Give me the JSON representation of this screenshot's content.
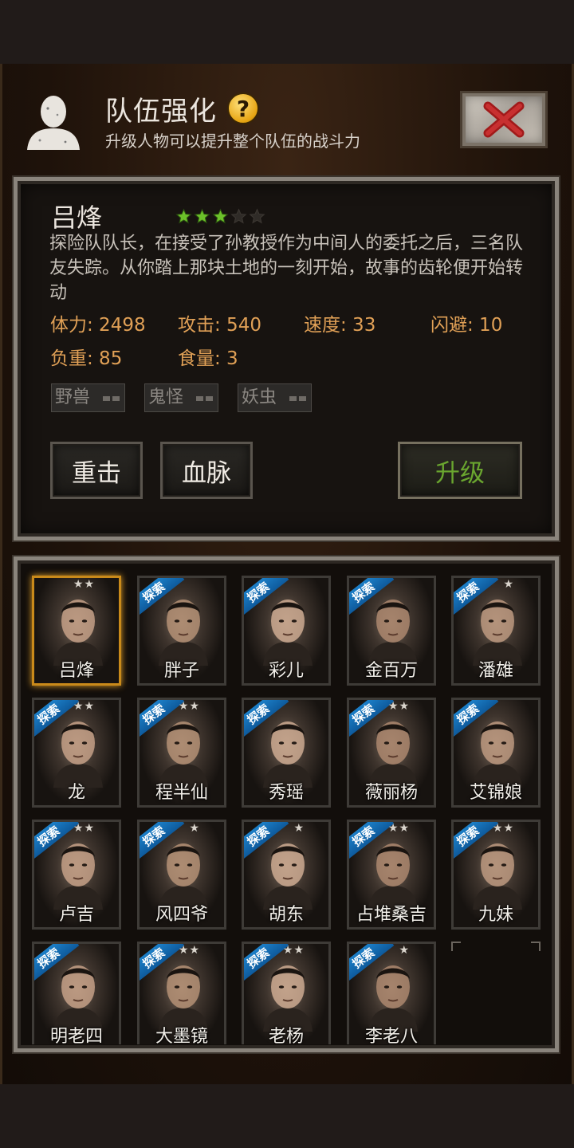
{
  "header": {
    "title": "队伍强化",
    "subtitle": "升级人物可以提升整个队伍的战斗力",
    "help_label": "?"
  },
  "character": {
    "name": "吕烽",
    "stars_filled": 3,
    "stars_total": 5,
    "description": "探险队队长，在接受了孙教授作为中间人的委托之后，三名队友失踪。从你踏上那块土地的一刻开始，故事的齿轮便开始转动",
    "stats": {
      "hp": "体力: 2498",
      "attack": "攻击: 540",
      "speed": "速度: 33",
      "dodge": "闪避: 10",
      "load": "负重: 85",
      "food": "食量: 3"
    },
    "tags": [
      "野兽",
      "鬼怪",
      "妖虫"
    ]
  },
  "buttons": {
    "heavy_strike": "重击",
    "bloodline": "血脉",
    "upgrade": "升级"
  },
  "roster": [
    {
      "name": "吕烽",
      "stars": "★★",
      "explore": false,
      "selected": true
    },
    {
      "name": "胖子",
      "stars": "",
      "explore": true,
      "selected": false
    },
    {
      "name": "彩儿",
      "stars": "",
      "explore": true,
      "selected": false
    },
    {
      "name": "金百万",
      "stars": "",
      "explore": true,
      "selected": false
    },
    {
      "name": "潘雄",
      "stars": "★",
      "explore": true,
      "selected": false
    },
    {
      "name": "龙",
      "stars": "★★",
      "explore": true,
      "selected": false
    },
    {
      "name": "程半仙",
      "stars": "★★",
      "explore": true,
      "selected": false
    },
    {
      "name": "秀瑶",
      "stars": "",
      "explore": true,
      "selected": false
    },
    {
      "name": "薇丽杨",
      "stars": "★★",
      "explore": true,
      "selected": false
    },
    {
      "name": "艾锦娘",
      "stars": "",
      "explore": true,
      "selected": false
    },
    {
      "name": "卢吉",
      "stars": "★★",
      "explore": true,
      "selected": false
    },
    {
      "name": "风四爷",
      "stars": "★",
      "explore": true,
      "selected": false
    },
    {
      "name": "胡东",
      "stars": "★",
      "explore": true,
      "selected": false
    },
    {
      "name": "占堆桑吉",
      "stars": "★★",
      "explore": true,
      "selected": false
    },
    {
      "name": "九妹",
      "stars": "★★",
      "explore": true,
      "selected": false
    },
    {
      "name": "明老四",
      "stars": "",
      "explore": true,
      "selected": false
    },
    {
      "name": "大墨镜",
      "stars": "★★",
      "explore": true,
      "selected": false
    },
    {
      "name": "老杨",
      "stars": "★★",
      "explore": true,
      "selected": false
    },
    {
      "name": "李老八",
      "stars": "★",
      "explore": true,
      "selected": false
    }
  ],
  "explore_badge": "探索",
  "colors": {
    "stat_text": "#e0a056",
    "upgrade_text": "#6aa62f",
    "explore_badge": "#1c7fc8",
    "selected_border": "#c98a1a",
    "star_filled": "#6cc12a"
  }
}
